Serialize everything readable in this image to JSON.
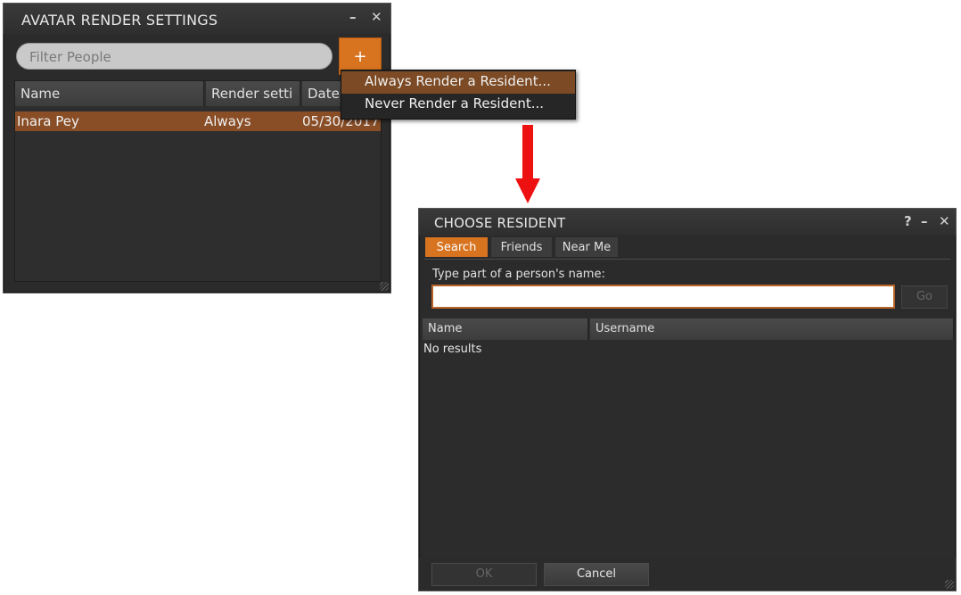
{
  "avatar_render_settings": {
    "title": "AVATAR RENDER SETTINGS",
    "minimize_glyph": "–",
    "close_glyph": "✕",
    "filter_placeholder": "Filter People",
    "add_button_label": "+",
    "columns": [
      "Name",
      "Render setti",
      "Date"
    ],
    "rows": [
      {
        "name": "Inara Pey",
        "render_setting": "Always",
        "date": "05/30/2017"
      }
    ]
  },
  "add_menu": {
    "items": [
      "Always Render a Resident...",
      "Never Render a Resident..."
    ]
  },
  "choose_resident": {
    "title": "CHOOSE RESIDENT",
    "help_glyph": "?",
    "minimize_glyph": "–",
    "close_glyph": "✕",
    "tabs": [
      "Search",
      "Friends",
      "Near Me"
    ],
    "active_tab": "Search",
    "prompt": "Type part of a person's name:",
    "name_input_value": "",
    "go_label": "Go",
    "columns": [
      "Name",
      "Username"
    ],
    "empty_text": "No results",
    "ok_label": "OK",
    "cancel_label": "Cancel"
  },
  "colors": {
    "accent": "#d8731f",
    "selection": "#8a4e27",
    "arrow": "#ee1111"
  }
}
